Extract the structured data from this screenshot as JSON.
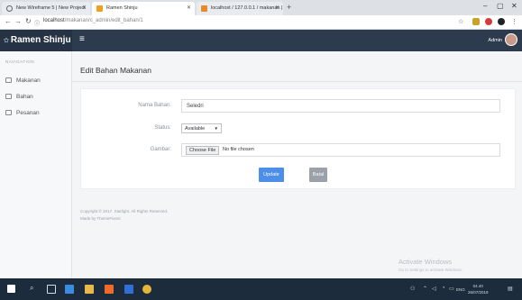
{
  "browser": {
    "tabs": [
      {
        "label": "New Wireframe 5 | New Project",
        "active": false
      },
      {
        "label": "Ramen Shinju",
        "active": true
      },
      {
        "label": "localhost / 127.0.0.1 / makanan |",
        "active": false
      }
    ],
    "url_host": "localhost",
    "url_path": "/makanan/c_admin/edit_bahan/1"
  },
  "app": {
    "brand": "Ramen Shinju",
    "user": "Admin",
    "colors": {
      "header": "#2c3b4e",
      "brand": "#263344",
      "accent": "#4d8ee8"
    }
  },
  "sidebar": {
    "heading": "NAVIGATION",
    "items": [
      {
        "label": "Makanan"
      },
      {
        "label": "Bahan"
      },
      {
        "label": "Pesanan"
      }
    ]
  },
  "page": {
    "title": "Edit Bahan Makanan"
  },
  "form": {
    "name_label": "Nama Bahan:",
    "name_value": "Seledri",
    "status_label": "Status:",
    "status_value": "Available",
    "image_label": "Gambar:",
    "choose_file": "Choose File",
    "no_file": "No file chosen",
    "update_label": "Update",
    "cancel_label": "Batal"
  },
  "footer": {
    "copyright": "Copyright © 2017. Starlight. All Rights Reserved.",
    "madeby": "Made by ThemeFixers"
  },
  "os": {
    "watermark_title": "Activate Windows",
    "watermark_sub": "Go to Settings to activate Windows.",
    "lang": "ENG",
    "time": "04.40",
    "date": "26/07/2019"
  }
}
